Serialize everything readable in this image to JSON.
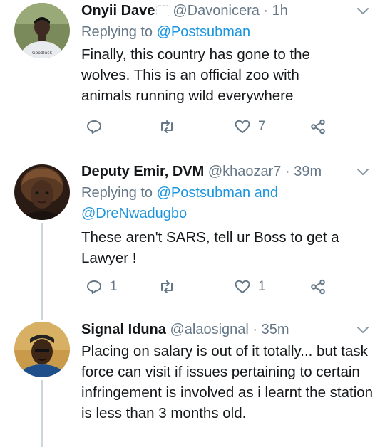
{
  "tweets": [
    {
      "name": "Onyii Dave",
      "handle": "@Davonicera",
      "sep": "·",
      "time": "1h",
      "replying_prefix": "Replying to ",
      "replying_to": "@Postsubman",
      "replying_and": "",
      "replying_to2": "",
      "text": "Finally, this country has gone to the wolves. This is an official zoo with animals running wild everywhere",
      "reply_count": "",
      "retweet_count": "",
      "like_count": "7",
      "avatar_shirt": "Goodluck"
    },
    {
      "name": "Deputy Emir, DVM",
      "handle": "@khaozar7",
      "sep": "·",
      "time": "39m",
      "replying_prefix": "Replying to ",
      "replying_to": "@Postsubman",
      "replying_and": " and",
      "replying_to2": "@DreNwadugbo",
      "text": "These aren't SARS, tell ur Boss to get a Lawyer !",
      "reply_count": "1",
      "retweet_count": "",
      "like_count": "1"
    },
    {
      "name": "Signal Iduna",
      "handle": "@alaosignal",
      "sep": "·",
      "time": "35m",
      "text": "Placing on salary is out of it totally... but task force can visit if issues pertaining to certain infringement is involved as i learnt the station is less than 3 months old."
    }
  ],
  "icons": {
    "reply": "reply-icon",
    "retweet": "retweet-icon",
    "like": "heart-icon",
    "share": "share-icon",
    "menu": "chevron-down-icon"
  },
  "colors": {
    "link": "#1b95e0",
    "secondary": "#657786",
    "divider": "#e6ecf0",
    "thread": "#ccd6dd"
  }
}
